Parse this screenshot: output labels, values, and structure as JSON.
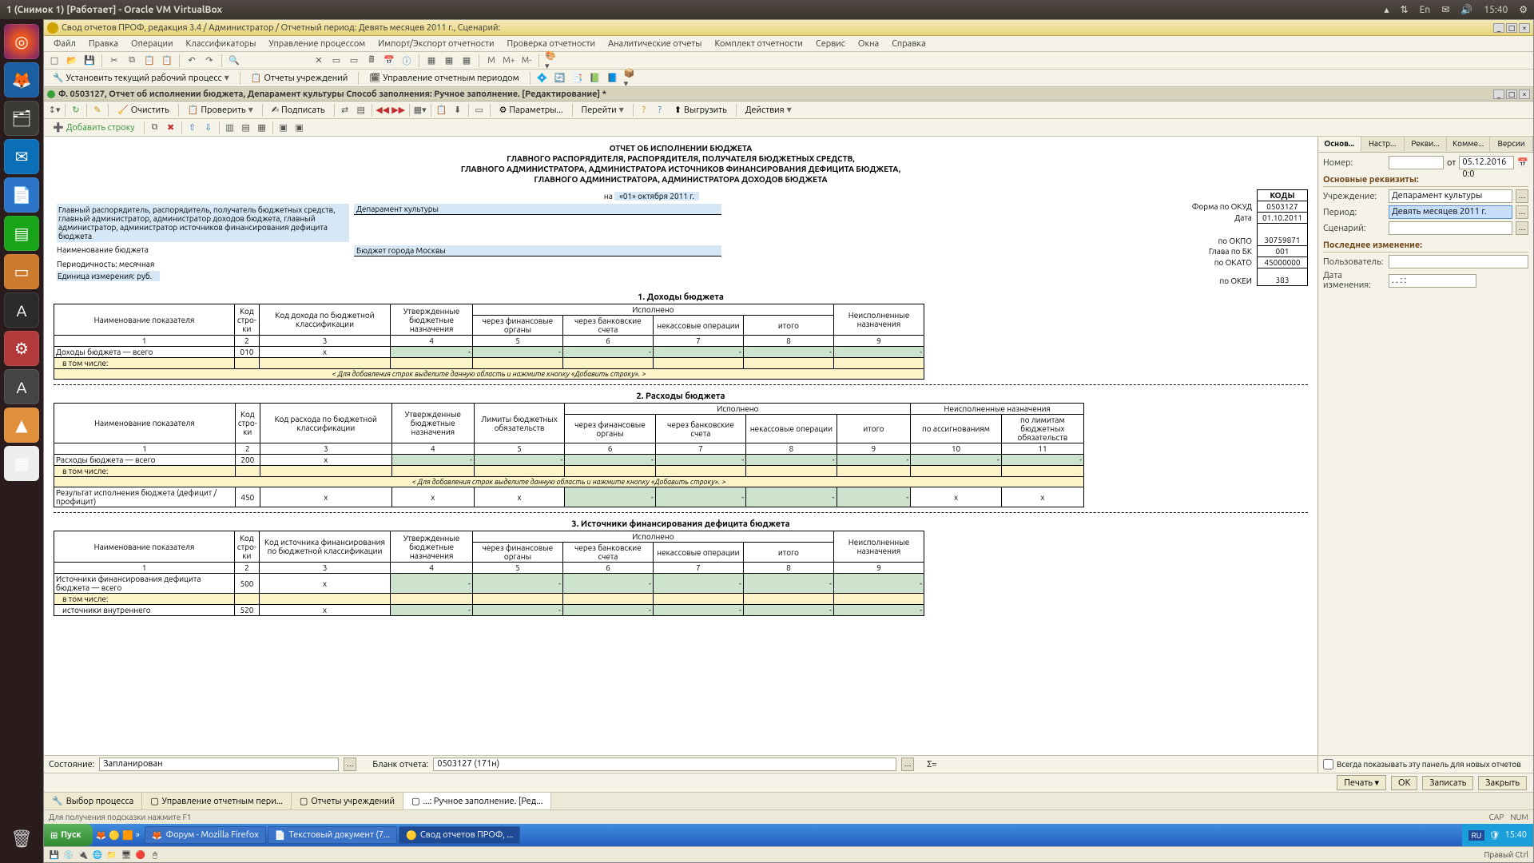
{
  "ubuntu": {
    "window_title": "1 (Снимок 1) [Работает] - Oracle VM VirtualBox",
    "lang": "En",
    "time": "15:40"
  },
  "app": {
    "title": "Свод отчетов ПРОФ, редакция 3.4 / Администратор / Отчетный период: Девять месяцев 2011 г., Сценарий:",
    "menu": [
      "Файл",
      "Правка",
      "Операции",
      "Классификаторы",
      "Управление процессом",
      "Импорт/Экспорт отчетности",
      "Проверка отчетности",
      "Аналитические отчеты",
      "Комплект отчетности",
      "Сервис",
      "Окна",
      "Справка"
    ],
    "tb2": {
      "set_process": "Установить текущий рабочий процесс",
      "reports": "Отчеты учреждений",
      "period": "Управление отчетным периодом"
    }
  },
  "doc_tab": "Ф. 0503127, Отчет об исполнении бюджета, Депарамент культуры Способ заполнения: Ручное заполнение. [Редактирование] *",
  "ctx": {
    "clear": "Очистить",
    "check": "Проверить",
    "sign": "Подписать",
    "params": "Параметры...",
    "goto": "Перейти",
    "upload": "Выгрузить",
    "actions": "Действия",
    "add_row": "Добавить строку"
  },
  "right": {
    "tabs": [
      "Основ...",
      "Настр...",
      "Рекви...",
      "Комме...",
      "Версии"
    ],
    "number_lbl": "Номер:",
    "from": "от",
    "date": "05.12.2016  0:0",
    "req_head": "Основные реквизиты:",
    "org_lbl": "Учреждение:",
    "org": "Депарамент культуры",
    "period_lbl": "Период:",
    "period": "Девять месяцев 2011 г.",
    "scen_lbl": "Сценарий:",
    "lastchg_head": "Последнее изменение:",
    "user_lbl": "Пользователь:",
    "chgdate_lbl": "Дата изменения:",
    "chgdate": ".  .      :  :",
    "always_show": "Всегда показывать эту панель для новых отчетов"
  },
  "report": {
    "title1": "ОТЧЕТ ОБ ИСПОЛНЕНИИ БЮДЖЕТА",
    "title2": "ГЛАВНОГО РАСПОРЯДИТЕЛЯ, РАСПОРЯДИТЕЛЯ, ПОЛУЧАТЕЛЯ БЮДЖЕТНЫХ СРЕДСТВ,",
    "title3": "ГЛАВНОГО АДМИНИСТРАТОРА, АДМИНИСТРАТОРА ИСТОЧНИКОВ ФИНАНСИРОВАНИЯ ДЕФИЦИТА БЮДЖЕТА,",
    "title4": "ГЛАВНОГО АДМИНИСТРАТОРА, АДМИНИСТРАТОРА ДОХОДОВ БЮДЖЕТА",
    "date_prefix": "на",
    "date": "«01» октября 2011 г.",
    "codes_head": "КОДЫ",
    "okud_lbl": "Форма по ОКУД",
    "okud": "0503127",
    "data_lbl": "Дата",
    "data": "01.10.2011",
    "okpo_lbl": "по ОКПО",
    "okpo": "30759871",
    "glava_lbl": "Глава по БК",
    "glava": "001",
    "okato_lbl": "по ОКАТО",
    "okato": "45000000",
    "okei_lbl": "по ОКЕИ",
    "okei": "383",
    "left_text": "Главный распорядитель, распорядитель, получатель бюджетных средств, главный администратор, администратор доходов бюджета, главный администратор, администратор источников финансирования дефицита бюджета",
    "org": "Депарамент культуры",
    "budget_lbl": "Наименование бюджета",
    "budget": "Бюджет города Москвы",
    "period_lbl": "Периодичность: месячная",
    "unit_lbl": "Единица измерения:  руб.",
    "sec1": "1. Доходы бюджета",
    "sec2": "2. Расходы бюджета",
    "sec3": "3. Источники финансирования дефицита бюджета",
    "hint": "< Для добавления строк выделите данную область и нажмите кнопку «Добавить строку». >",
    "cols1": {
      "name": "Наименование показателя",
      "code": "Код стро-ки",
      "kd": "Код дохода по бюджетной классификации",
      "appr": "Утвержденные бюджетные назначения",
      "exec": "Исполнено",
      "fin": "через финансовые органы",
      "bank": "через банковские счета",
      "nonc": "некассовые операции",
      "total": "итого",
      "unexec": "Неисполненные назначения"
    },
    "cols2": {
      "kd": "Код расхода по бюджетной классификации",
      "lbo": "Лимиты бюджетных обязательств",
      "unexec": "Неисполненные назначения",
      "assig": "по ассигнованиям",
      "lbo2": "по лимитам бюджетных обязательств"
    },
    "cols3": {
      "kd": "Код источника финансирования по бюджетной классификации"
    },
    "row_income": "Доходы бюджета — всего",
    "row_incl": "в том числе:",
    "row_expense": "Расходы бюджета — всего",
    "row_result": "Результат исполнения бюджета (дефицит / профицит)",
    "row_src": "Источники финансирования дефицита бюджета — всего",
    "row_src_int": "источники внутреннего"
  },
  "footer": {
    "state_lbl": "Состояние:",
    "state": "Запланирован",
    "blank_lbl": "Бланк отчета:",
    "blank": "0503127 (171н)",
    "sigma": "Σ="
  },
  "actions": {
    "print": "Печать",
    "ok": "OK",
    "save": "Записать",
    "close": "Закрыть"
  },
  "win_tabs": [
    "Выбор процесса",
    "Управление отчетным пери...",
    "Отчеты учреждений",
    "...: Ручное заполнение. [Ред..."
  ],
  "status_hint": "Для получения подсказки нажмите F1",
  "status_right": [
    "CAP",
    "NUM"
  ],
  "xp": {
    "start": "Пуск",
    "tasks": [
      "Форум - Mozilla Firefox",
      "Текстовый документ (7...",
      "Свод отчетов ПРОФ, ..."
    ],
    "lang": "RU",
    "time": "15:40"
  },
  "vm_status": "Правый Ctrl"
}
